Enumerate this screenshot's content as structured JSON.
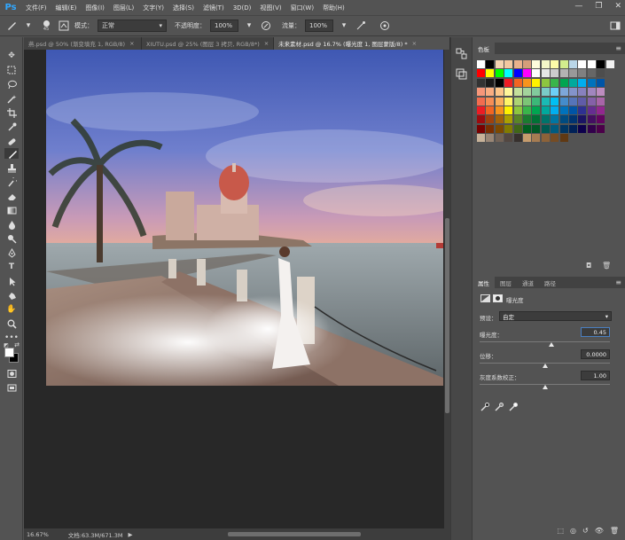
{
  "menubar": {
    "logo": "Ps",
    "items": [
      "文件(F)",
      "编辑(E)",
      "图像(I)",
      "图层(L)",
      "文字(Y)",
      "选择(S)",
      "滤镜(T)",
      "3D(D)",
      "视图(V)",
      "窗口(W)",
      "帮助(H)"
    ],
    "controls": [
      "—",
      "❐",
      "✕"
    ]
  },
  "options": {
    "size": "45",
    "mode_label": "模式：",
    "mode_value": "正常",
    "opacity_label": "不透明度：",
    "opacity_value": "100%",
    "flow_label": "流量：",
    "flow_value": "100%"
  },
  "tabs": [
    {
      "label": "燕.psd @ 50% (渐变填充 1, RGB/8)",
      "close": "×"
    },
    {
      "label": "XIUTU.psd @ 25% (图层 3 拷贝, RGB/8*)",
      "close": "×"
    },
    {
      "label": "未来素材.psd @ 16.7% (曝光度 1, 图层蒙版/8) *",
      "close": "×"
    }
  ],
  "status": {
    "zoom": "16.67%",
    "doc": "文档:63.3M/671.3M",
    "arrow": "▶"
  },
  "swatches_panel": {
    "title": "色板",
    "colors": [
      [
        "#ffffff",
        "#000000",
        "#f4d3b0",
        "#f2c8a0",
        "#e9b28c",
        "#d49e7a",
        "#fdfcdc",
        "#f3f6c8",
        "#fcfba8",
        "#d3ec8d",
        "#b9d6e8",
        "#ffffff",
        "#ffffff",
        "#000000",
        "#f2f2f2"
      ],
      [
        "#ff0000",
        "#ffff00",
        "#00ff00",
        "#00ffff",
        "#0000ff",
        "#ff00ff",
        "#ffffff",
        "#e6e6e6",
        "#cccccc",
        "#b3b3b3",
        "#999999",
        "#808080",
        "#666666",
        "#4d4d4d"
      ],
      [
        "#333333",
        "#1a1a1a",
        "#000000",
        "#ed1c24",
        "#f26522",
        "#f7941d",
        "#fff200",
        "#8dc63f",
        "#39b54a",
        "#00a651",
        "#00a99d",
        "#00aeef",
        "#0072bc",
        "#0054a6"
      ],
      [
        "#f69679",
        "#f9ad81",
        "#fdc689",
        "#fff799",
        "#c4df9b",
        "#a3d39c",
        "#82ca9d",
        "#7accc8",
        "#6dcff6",
        "#7da7d9",
        "#8393ca",
        "#8781bd",
        "#a186be",
        "#bd8cbf"
      ],
      [
        "#f26c4f",
        "#f68e55",
        "#fbaf5d",
        "#fff467",
        "#acd373",
        "#7cc576",
        "#3bb878",
        "#1abbb4",
        "#00bff3",
        "#448ccb",
        "#5574b9",
        "#605ca8",
        "#8560a8",
        "#a864a8"
      ],
      [
        "#ed1c24",
        "#f26522",
        "#f7941d",
        "#fff200",
        "#8dc63f",
        "#39b54a",
        "#00a651",
        "#00a99d",
        "#00aeef",
        "#0072bc",
        "#0054a6",
        "#2e3192",
        "#662d91",
        "#92278f"
      ],
      [
        "#9e0b0f",
        "#a0410d",
        "#a36209",
        "#aba000",
        "#598527",
        "#1a7b30",
        "#007236",
        "#00746b",
        "#0076a3",
        "#004b80",
        "#003471",
        "#1b1464",
        "#440e62",
        "#630460"
      ],
      [
        "#790000",
        "#7b2e00",
        "#7d4900",
        "#827b00",
        "#406618",
        "#005e20",
        "#005826",
        "#005952",
        "#005b7f",
        "#003663",
        "#002157",
        "#0d004c",
        "#32004b",
        "#4b0049"
      ],
      [
        "#c7b299",
        "#998675",
        "#736357",
        "#534741",
        "#37302d",
        "#c69c6d",
        "#a67c52",
        "#8c6239",
        "#754c24",
        "#603913"
      ]
    ]
  },
  "properties_panel": {
    "tabs": [
      "属性",
      "图层",
      "通道",
      "路径"
    ],
    "adjustment_title": "曝光度",
    "preset_label": "预设：",
    "preset_value": "自定",
    "exposure_label": "曝光度：",
    "exposure_value": "0.45",
    "exposure_level": 0.55,
    "offset_label": "位移：",
    "offset_value": "0.0000",
    "offset_level": 0.5,
    "gamma_label": "灰度系数校正：",
    "gamma_value": "1.00",
    "gamma_level": 0.5
  }
}
